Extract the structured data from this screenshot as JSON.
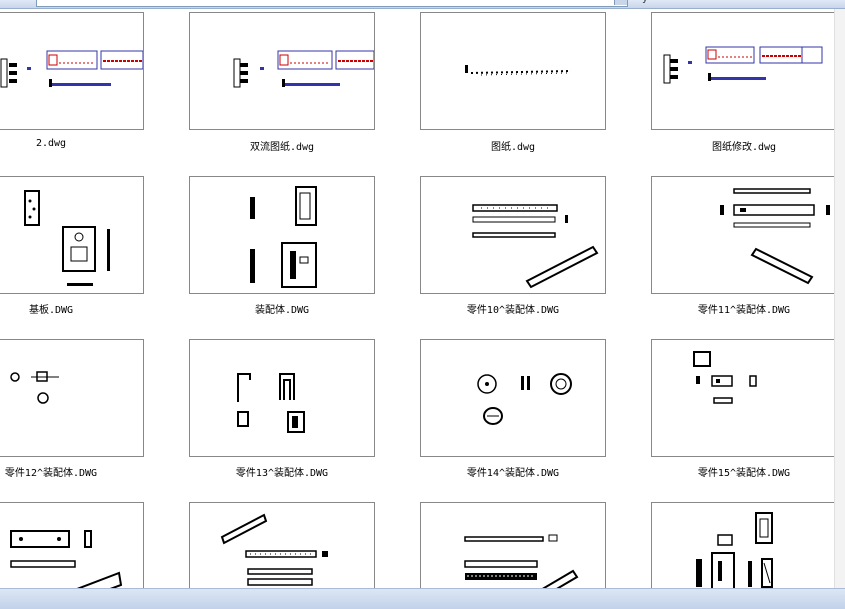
{
  "files": [
    {
      "name": "2.dwg"
    },
    {
      "name": "双流图纸.dwg"
    },
    {
      "name": "图纸.dwg"
    },
    {
      "name": "图纸修改.dwg"
    },
    {
      "name": "基板.DWG"
    },
    {
      "name": "装配体.DWG"
    },
    {
      "name": "零件10^装配体.DWG"
    },
    {
      "name": "零件11^装配体.DWG"
    },
    {
      "name": "零件12^装配体.DWG"
    },
    {
      "name": "零件13^装配体.DWG"
    },
    {
      "name": "零件14^装配体.DWG"
    },
    {
      "name": "零件15^装配体.DWG"
    },
    {
      "name": ""
    },
    {
      "name": ""
    },
    {
      "name": ""
    },
    {
      "name": ""
    }
  ],
  "colors": {
    "accent_red": "#cc0000",
    "frame_blue": "#3333aa",
    "thumb_border": "#888888"
  }
}
